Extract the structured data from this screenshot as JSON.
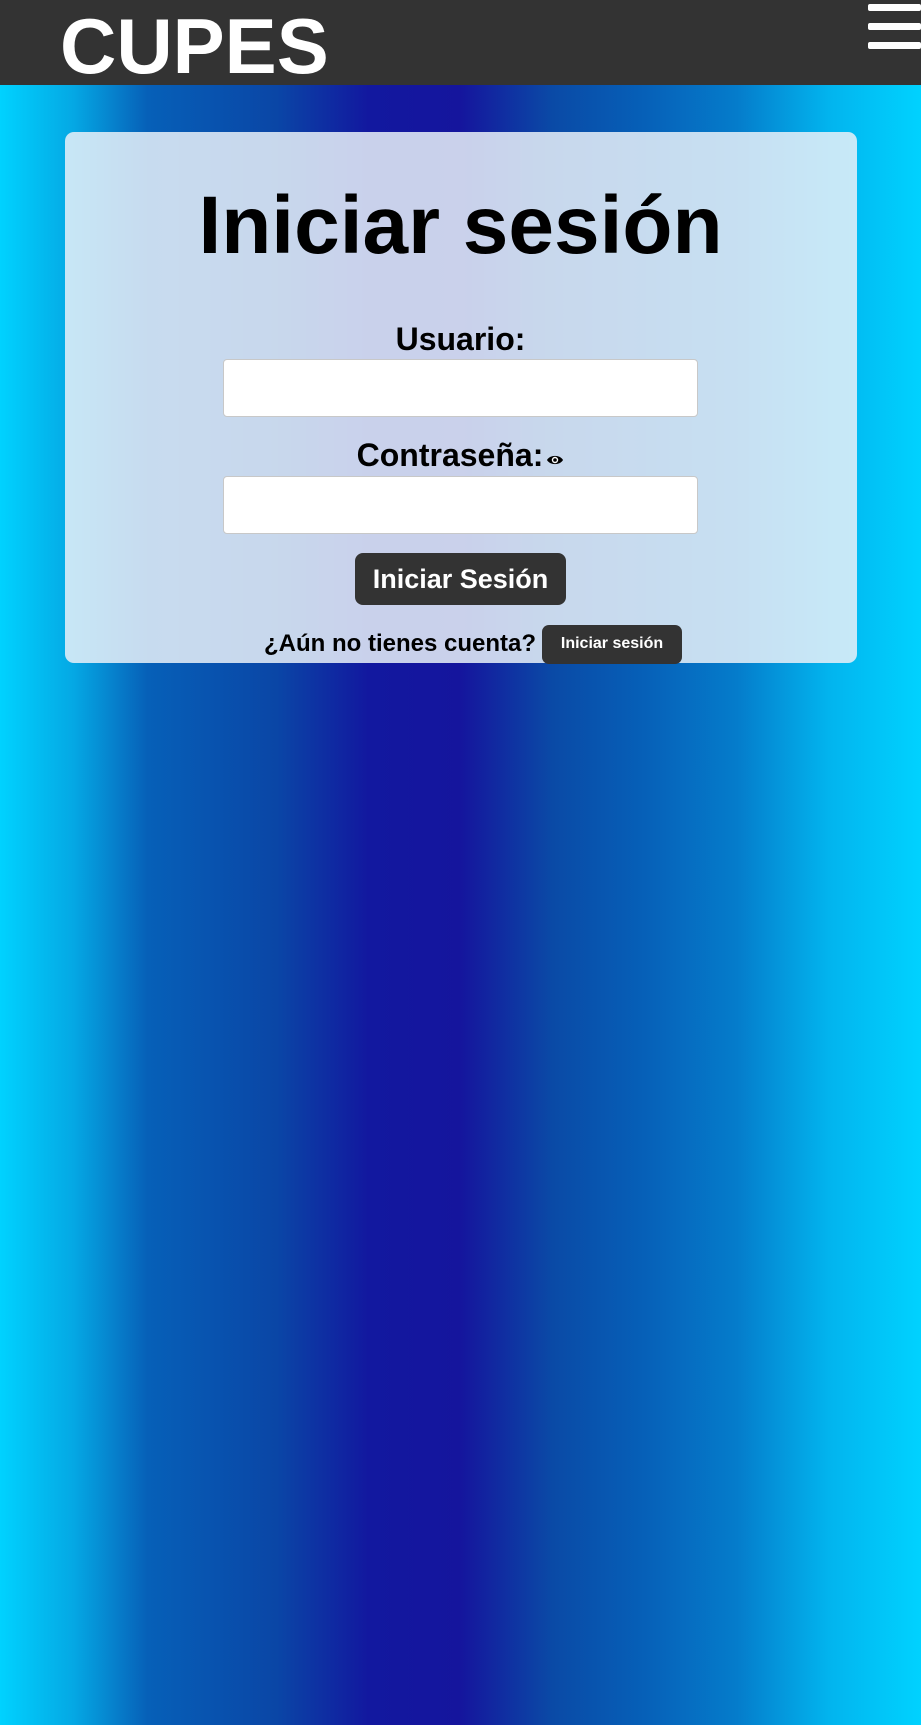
{
  "header": {
    "brand": "CUPES",
    "menu_icon": "hamburger-menu-icon"
  },
  "login": {
    "title": "Iniciar sesión",
    "username_label": "Usuario:",
    "username_value": "",
    "password_label": "Contraseña:",
    "password_value": "",
    "password_toggle_icon": "eye-icon",
    "submit_label": "Iniciar Sesión",
    "register_prompt": "¿Aún no tienes cuenta?",
    "register_button_label": "Iniciar sesión"
  },
  "colors": {
    "header_bg": "#333333",
    "button_bg": "#333333",
    "gradient_edge": "#00d2ff",
    "gradient_center": "#15159d"
  }
}
